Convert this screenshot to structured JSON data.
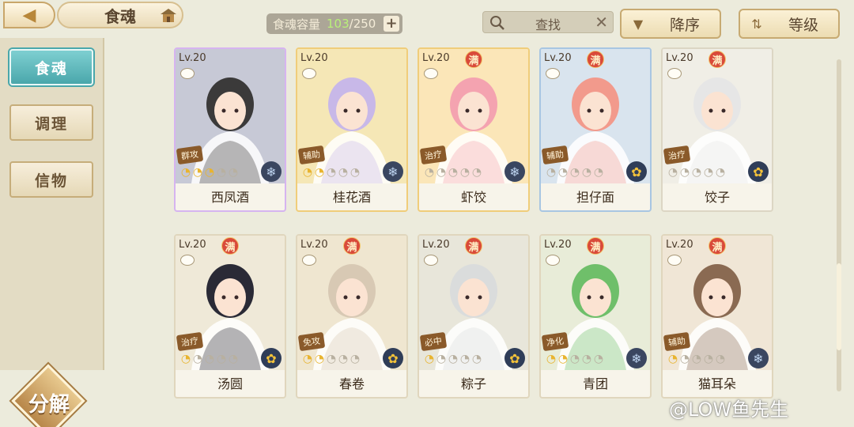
{
  "header": {
    "back_icon": "back-arrow-icon",
    "title": "食魂",
    "home_icon": "pavilion-icon",
    "capacity_label": "食魂容量",
    "capacity_current": "103",
    "capacity_total": "/250",
    "add_label": "+"
  },
  "search": {
    "placeholder": "查找",
    "clear_label": "✕"
  },
  "sort": {
    "order_label": "降序",
    "field_label": "等级"
  },
  "sidebar": {
    "items": [
      {
        "label": "食魂",
        "active": true
      },
      {
        "label": "调理",
        "active": false
      },
      {
        "label": "信物",
        "active": false
      }
    ],
    "decompose_label": "分解"
  },
  "cards": [
    {
      "level": "Lv.20",
      "max": "",
      "role": "群攻",
      "stars_on": 3,
      "stars_total": 5,
      "element": "snowflake",
      "name": "西凤酒",
      "frame": "#d6b4f0",
      "bg": "#c7c9d6",
      "hair": "#3b3a3a"
    },
    {
      "level": "Lv.20",
      "max": "",
      "role": "辅助",
      "stars_on": 2,
      "stars_total": 5,
      "element": "snowflake",
      "name": "桂花酒",
      "frame": "#f0cd7a",
      "bg": "#f5e7b6",
      "hair": "#c8b8e8"
    },
    {
      "level": "Lv.20",
      "max": "满",
      "role": "治疗",
      "stars_on": 0,
      "stars_total": 5,
      "element": "snowflake",
      "name": "虾饺",
      "frame": "#f0cd7a",
      "bg": "#fbe6b8",
      "hair": "#f4a3b0"
    },
    {
      "level": "Lv.20",
      "max": "满",
      "role": "辅助",
      "stars_on": 0,
      "stars_total": 5,
      "element": "flower",
      "name": "担仔面",
      "frame": "#a8c6e2",
      "bg": "#d9e4ee",
      "hair": "#f29a8c"
    },
    {
      "level": "Lv.20",
      "max": "满",
      "role": "治疗",
      "stars_on": 0,
      "stars_total": 5,
      "element": "flower",
      "name": "饺子",
      "frame": "#dcd6c4",
      "bg": "#f0eee6",
      "hair": "#e6e6e6"
    },
    {
      "level": "Lv.20",
      "max": "满",
      "role": "治疗",
      "stars_on": 1,
      "stars_total": 5,
      "element": "flower",
      "name": "汤圆",
      "frame": "#e0d6bd",
      "bg": "#efe9d8",
      "hair": "#2a2a36"
    },
    {
      "level": "Lv.20",
      "max": "满",
      "role": "免攻",
      "stars_on": 2,
      "stars_total": 5,
      "element": "flower",
      "name": "春卷",
      "frame": "#e0d6bd",
      "bg": "#efe6d0",
      "hair": "#d8c9b4"
    },
    {
      "level": "Lv.20",
      "max": "满",
      "role": "必中",
      "stars_on": 1,
      "stars_total": 5,
      "element": "flower",
      "name": "粽子",
      "frame": "#e0d6bd",
      "bg": "#e8e6da",
      "hair": "#dadcdc"
    },
    {
      "level": "Lv.20",
      "max": "满",
      "role": "净化",
      "stars_on": 2,
      "stars_total": 5,
      "element": "snowflake",
      "name": "青团",
      "frame": "#e0d6bd",
      "bg": "#e8ecd8",
      "hair": "#6fbf6a"
    },
    {
      "level": "Lv.20",
      "max": "满",
      "role": "辅助",
      "stars_on": 1,
      "stars_total": 5,
      "element": "snowflake",
      "name": "猫耳朵",
      "frame": "#e0d6bd",
      "bg": "#f0e6d6",
      "hair": "#8a6a52"
    }
  ],
  "watermark": "@LOW鱼先生",
  "colors": {
    "accent_teal": "#4aa7ab",
    "gold": "#e8b430",
    "max_badge": "#d94a3a",
    "capacity_green": "#b9f07a"
  }
}
